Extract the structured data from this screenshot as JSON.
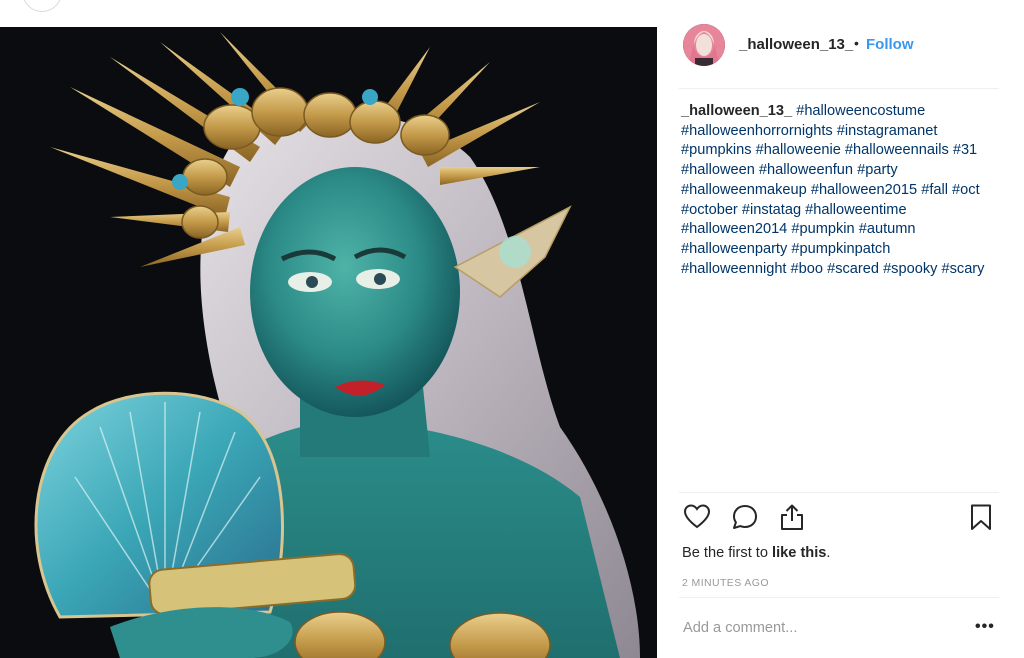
{
  "post": {
    "photo_alt": "",
    "username": "_halloween_13_",
    "separator": "•",
    "follow_label": "Follow",
    "caption_user": "_halloween_13_",
    "hashtags": [
      "#halloweencostume",
      "#halloweenhorrornights",
      "#instagramanet",
      "#pumpkins",
      "#halloweenie",
      "#halloweennails",
      "#31",
      "#halloween",
      "#halloweenfun",
      "#party",
      "#halloweenmakeup",
      "#halloween2015",
      "#fall",
      "#oct",
      "#october",
      "#instatag",
      "#halloweentime",
      "#halloween2014",
      "#pumpkin",
      "#autumn",
      "#halloweenparty",
      "#pumpkinpatch",
      "#halloweennight",
      "#boo",
      "#scared",
      "#spooky",
      "#scary"
    ],
    "likes_prefix": "Be the first to",
    "likes_action": "like this",
    "likes_suffix": ".",
    "timestamp": "2 MINUTES AGO",
    "comment_placeholder": "Add a comment...",
    "more_label": "•••"
  },
  "icons": {
    "like": "heart-icon",
    "comment": "comment-bubble-icon",
    "share": "share-upload-icon",
    "save": "bookmark-icon",
    "more": "more-options-icon"
  },
  "colors": {
    "link_blue": "#3897f0",
    "hashtag": "#003569",
    "text": "#262626",
    "muted": "#999999",
    "divider": "#efefef"
  }
}
